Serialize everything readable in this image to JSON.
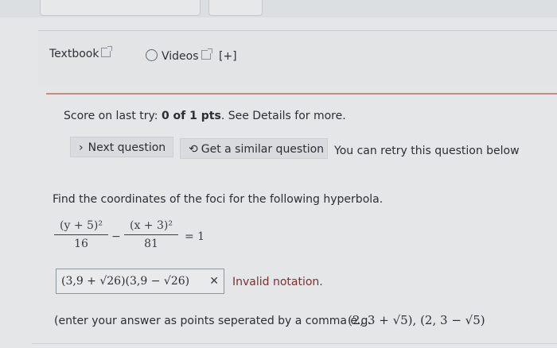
{
  "toolbar": {
    "textbook_label": "Textbook",
    "videos_label": "Videos",
    "videos_extra": "[+]",
    "icons": [
      "external-link-icon",
      "video-icon"
    ]
  },
  "score": {
    "prefix": "Score on last try: ",
    "value": "0 of 1 pts",
    "suffix": ". See Details for more."
  },
  "actions": {
    "next_label": "Next question",
    "similar_label": "Get a similar question",
    "retry_text": "You can retry this question below",
    "next_icon": "chevron-right-icon",
    "similar_icon": "refresh-icon"
  },
  "question": {
    "prompt": "Find the coordinates of the foci for the following hyperbola.",
    "numerator1": "(y + 5)²",
    "denominator1": "16",
    "minus": "−",
    "numerator2": "(x + 3)²",
    "denominator2": "81",
    "rhs": "= 1"
  },
  "answer": {
    "value": "(3,9 + √26)(3,9 − √26)",
    "status_icon": "x-mark-icon",
    "error_text": "Invalid notation."
  },
  "hint": {
    "text": "(enter your answer as points seperated by a comma e.g.",
    "example": "(2, 3 + √5), (2, 3 − √5)"
  },
  "colors": {
    "background": "#e4e6e8",
    "divider_red": "#c98a86",
    "error_text": "#7a3030"
  }
}
